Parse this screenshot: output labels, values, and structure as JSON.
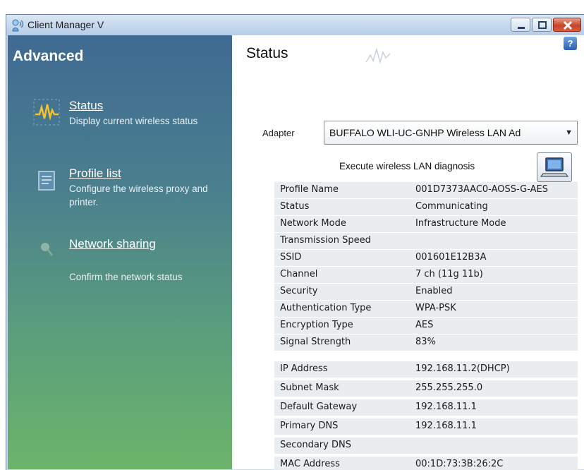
{
  "window": {
    "title": "Client Manager V"
  },
  "sidebar": {
    "title": "Advanced",
    "items": [
      {
        "label": "Status",
        "description": "Display current wireless status",
        "icon": "status-wave-icon"
      },
      {
        "label": "Profile list",
        "description": "Configure the wireless proxy and printer.",
        "icon": "profile-list-icon"
      },
      {
        "label": "Network sharing",
        "description": "Confirm the network status",
        "icon": "network-search-icon"
      }
    ]
  },
  "main": {
    "title": "Status",
    "help": "?",
    "adapter": {
      "label": "Adapter",
      "value": "BUFFALO WLI-UC-GNHP  Wireless LAN Ad"
    },
    "diagnosis": {
      "label": "Execute wireless LAN diagnosis"
    },
    "wireless_info": [
      {
        "key": "Profile Name",
        "value": "001D7373AAC0-AOSS-G-AES"
      },
      {
        "key": "Status",
        "value": "Communicating"
      },
      {
        "key": "Network Mode",
        "value": "Infrastructure Mode"
      },
      {
        "key": "Transmission Speed",
        "value": ""
      },
      {
        "key": "SSID",
        "value": "001601E12B3A"
      },
      {
        "key": "Channel",
        "value": "7 ch (11g 11b)"
      },
      {
        "key": "Security",
        "value": "Enabled"
      },
      {
        "key": "Authentication Type",
        "value": "WPA-PSK"
      },
      {
        "key": "Encryption Type",
        "value": "AES"
      },
      {
        "key": "Signal Strength",
        "value": "83%"
      }
    ],
    "network_info": [
      {
        "key": "IP Address",
        "value": "192.168.11.2(DHCP)"
      },
      {
        "key": "Subnet Mask",
        "value": "255.255.255.0"
      },
      {
        "key": "Default Gateway",
        "value": "192.168.11.1"
      },
      {
        "key": "Primary DNS",
        "value": "192.168.11.1"
      },
      {
        "key": "Secondary DNS",
        "value": ""
      },
      {
        "key": "MAC Address",
        "value": "00:1D:73:3B:26:2C"
      }
    ]
  },
  "colors": {
    "sidebar_top": "#3f6a92",
    "sidebar_bottom": "#6cb46a",
    "row_shade": "#e9edf0"
  }
}
